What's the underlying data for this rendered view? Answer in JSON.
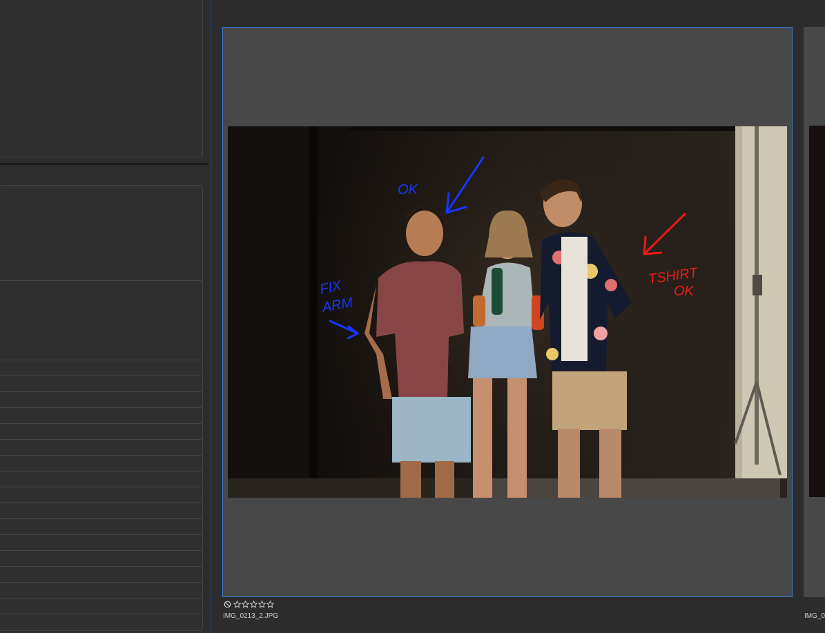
{
  "gallery": {
    "selected": {
      "filename": "IMG_0213_2.JPG",
      "rating": 0,
      "max_rating": 5,
      "annotations": {
        "note1": "OK",
        "note2_line1": "FIX",
        "note2_line2": "ARM",
        "note3_line1": "TSHIRT",
        "note3_line2": "OK",
        "blue_color": "#1636ff",
        "red_color": "#f01818"
      }
    },
    "next": {
      "filename": "IMG_0"
    }
  },
  "colors": {
    "selection_border": "#3a78d0",
    "thumb_background": "#484848",
    "panel_background": "#2d2d2d"
  },
  "icons": {
    "reject": "reject-icon",
    "star": "star-outline-icon"
  }
}
